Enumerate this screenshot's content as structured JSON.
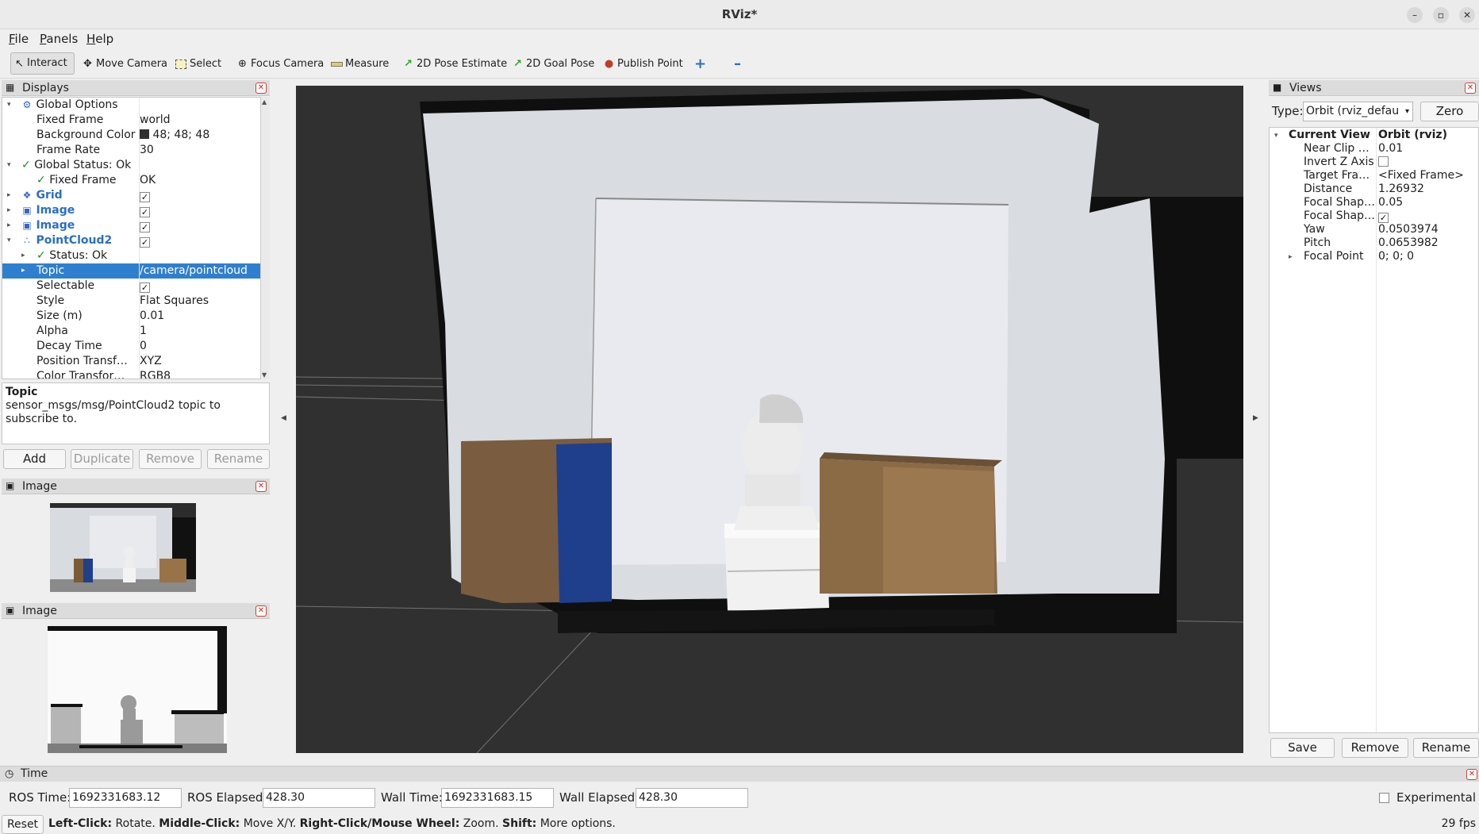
{
  "window": {
    "title": "RViz*"
  },
  "menu": {
    "file": "File",
    "panels": "Panels",
    "help": "Help"
  },
  "toolbar": {
    "interact": "Interact",
    "move_camera": "Move Camera",
    "select": "Select",
    "focus_camera": "Focus Camera",
    "measure": "Measure",
    "pose_estimate": "2D Pose Estimate",
    "goal_pose": "2D Goal Pose",
    "publish_point": "Publish Point"
  },
  "displays": {
    "title": "Displays",
    "rows": [
      {
        "label": "Global Options",
        "value": ""
      },
      {
        "label": "Fixed Frame",
        "value": "world"
      },
      {
        "label": "Background Color",
        "value": "48; 48; 48"
      },
      {
        "label": "Frame Rate",
        "value": "30"
      },
      {
        "label": "Global Status: Ok",
        "value": ""
      },
      {
        "label": "Fixed Frame",
        "value": "OK"
      },
      {
        "label": "Grid",
        "value": ""
      },
      {
        "label": "Image",
        "value": ""
      },
      {
        "label": "Image",
        "value": ""
      },
      {
        "label": "PointCloud2",
        "value": ""
      },
      {
        "label": "Status: Ok",
        "value": ""
      },
      {
        "label": "Topic",
        "value": "/camera/pointcloud"
      },
      {
        "label": "Selectable",
        "value": ""
      },
      {
        "label": "Style",
        "value": "Flat Squares"
      },
      {
        "label": "Size (m)",
        "value": "0.01"
      },
      {
        "label": "Alpha",
        "value": "1"
      },
      {
        "label": "Decay Time",
        "value": "0"
      },
      {
        "label": "Position Transf…",
        "value": "XYZ"
      },
      {
        "label": "Color Transfor…",
        "value": "RGB8"
      }
    ],
    "desc_title": "Topic",
    "desc_text": "sensor_msgs/msg/PointCloud2 topic to subscribe to.",
    "buttons": {
      "add": "Add",
      "duplicate": "Duplicate",
      "remove": "Remove",
      "rename": "Rename"
    }
  },
  "image_panel_1": {
    "title": "Image"
  },
  "image_panel_2": {
    "title": "Image"
  },
  "views": {
    "title": "Views",
    "type_label": "Type:",
    "type_value": "Orbit (rviz_defau",
    "zero": "Zero",
    "current_view": {
      "label": "Current View",
      "value": "Orbit (rviz)"
    },
    "rows": [
      {
        "label": "Near Clip …",
        "value": "0.01"
      },
      {
        "label": "Invert Z Axis",
        "value": ""
      },
      {
        "label": "Target Fra…",
        "value": "<Fixed Frame>"
      },
      {
        "label": "Distance",
        "value": "1.26932"
      },
      {
        "label": "Focal Shap…",
        "value": "0.05"
      },
      {
        "label": "Focal Shap…",
        "value": ""
      },
      {
        "label": "Yaw",
        "value": "0.0503974"
      },
      {
        "label": "Pitch",
        "value": "0.0653982"
      },
      {
        "label": "Focal Point",
        "value": "0; 0; 0"
      }
    ],
    "buttons": {
      "save": "Save",
      "remove": "Remove",
      "rename": "Rename"
    }
  },
  "time": {
    "title": "Time",
    "ros_time_label": "ROS Time:",
    "ros_time": "1692331683.12",
    "ros_elapsed_label": "ROS Elapsed:",
    "ros_elapsed": "428.30",
    "wall_time_label": "Wall Time:",
    "wall_time": "1692331683.15",
    "wall_elapsed_label": "Wall Elapsed:",
    "wall_elapsed": "428.30",
    "experimental": "Experimental"
  },
  "status": {
    "reset": "Reset",
    "left_click": "Left-Click:",
    "left_click_desc": " Rotate. ",
    "middle_click": "Middle-Click:",
    "middle_click_desc": " Move X/Y. ",
    "right_click": "Right-Click/Mouse Wheel:",
    "right_click_desc": " Zoom. ",
    "shift": "Shift:",
    "shift_desc": " More options.",
    "fps": "29 fps"
  },
  "colors": {
    "selection": "#2f7fd1",
    "background": "#303030",
    "display_accent": "#2a6fc4"
  }
}
